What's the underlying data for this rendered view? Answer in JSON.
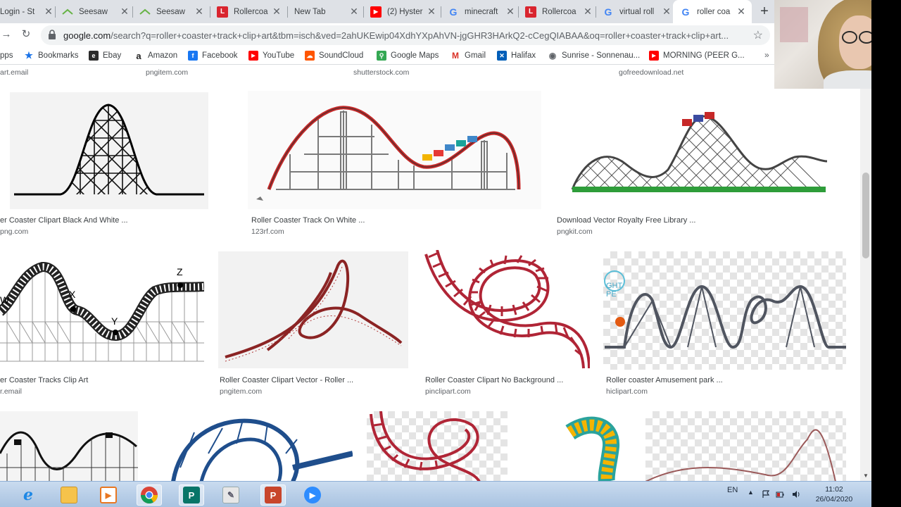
{
  "tabs": [
    {
      "label": "Login - St",
      "icon": "generic-page-icon",
      "color": "#5f6368"
    },
    {
      "label": "Seesaw",
      "icon": "seesaw-icon",
      "color": "#67b346"
    },
    {
      "label": "Seesaw",
      "icon": "seesaw-icon",
      "color": "#67b346"
    },
    {
      "label": "Rollercoa",
      "icon": "red-l-icon",
      "color": "#d9252f"
    },
    {
      "label": "New Tab",
      "icon": "",
      "color": ""
    },
    {
      "label": "(2) Hyster",
      "icon": "youtube-icon",
      "color": "#ff0000"
    },
    {
      "label": "minecraft",
      "icon": "google-icon",
      "color": "#4285f4"
    },
    {
      "label": "Rollercoa",
      "icon": "red-l-icon",
      "color": "#d9252f"
    },
    {
      "label": "virtual roll",
      "icon": "google-icon",
      "color": "#4285f4"
    },
    {
      "label": "roller coa",
      "icon": "google-icon",
      "color": "#4285f4"
    }
  ],
  "address": {
    "host": "google.com",
    "path": "/search?q=roller+coaster+track+clip+art&tbm=isch&ved=2ahUKEwip04XdhYXpAhVN-jgGHR3HArkQ2-cCegQIABAA&oq=roller+coaster+track+clip+art..."
  },
  "bookmarks": [
    {
      "label": "pps",
      "icon": "apps-grid-icon",
      "color": "#4285f4"
    },
    {
      "label": "Bookmarks",
      "icon": "star-icon",
      "color": "#1a73e8"
    },
    {
      "label": "Ebay",
      "icon": "ebay-icon",
      "color": "#2b2b2b"
    },
    {
      "label": "Amazon",
      "icon": "amazon-icon",
      "color": "#222222"
    },
    {
      "label": "Facebook",
      "icon": "facebook-icon",
      "color": "#1877f2"
    },
    {
      "label": "YouTube",
      "icon": "youtube-icon",
      "color": "#ff0000"
    },
    {
      "label": "SoundCloud",
      "icon": "soundcloud-icon",
      "color": "#ff5500"
    },
    {
      "label": "Google Maps",
      "icon": "maps-pin-icon",
      "color": "#34a853"
    },
    {
      "label": "Gmail",
      "icon": "gmail-icon",
      "color": "#d93025"
    },
    {
      "label": "Halifax",
      "icon": "halifax-icon",
      "color": "#005eb8"
    },
    {
      "label": "Sunrise - Sonnenau...",
      "icon": "globe-icon",
      "color": "#5f6368"
    },
    {
      "label": "MORNING (PEER G...",
      "icon": "youtube-icon",
      "color": "#ff0000"
    }
  ],
  "top_sources": [
    "art.email",
    "pngitem.com",
    "shutterstock.com",
    "gofreedownload.net"
  ],
  "row1": [
    {
      "title": "er Coaster Clipart Black And White ...",
      "site": "png.com"
    },
    {
      "title": "Roller Coaster Track On White ...",
      "site": "123rf.com"
    },
    {
      "title": "Download Vector Royalty Free Library ...",
      "site": "pngkit.com"
    }
  ],
  "row2": [
    {
      "title": "er Coaster Tracks Clip Art",
      "site": "r.email",
      "labels": [
        "W",
        "X",
        "Y",
        "Z"
      ]
    },
    {
      "title": "Roller Coaster Clipart Vector - Roller ...",
      "site": "pngitem.com"
    },
    {
      "title": "Roller Coaster Clipart No Background ...",
      "site": "pinclipart.com"
    },
    {
      "title": "Roller coaster Amusement park ...",
      "site": "hiclipart.com",
      "badge": "GHT\nPE"
    }
  ],
  "taskbar": {
    "apps": [
      "ie-icon",
      "explorer-folder-icon",
      "media-player-icon",
      "chrome-icon",
      "publisher-icon",
      "notepad-icon",
      "powerpoint-icon",
      "zoom-icon"
    ],
    "lang": "EN",
    "time": "11:02",
    "date": "26/04/2020"
  }
}
